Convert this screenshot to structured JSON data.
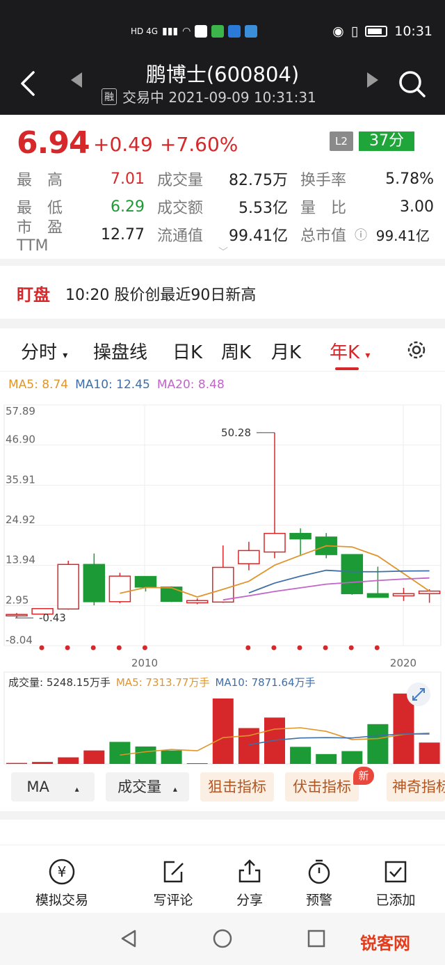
{
  "status": {
    "left_label": "HD 4G",
    "time": "10:31"
  },
  "header": {
    "title": "鹏博士(600804)",
    "rong": "融",
    "subtitle": "交易中 2021-09-09 10:31:31"
  },
  "quote": {
    "price": "6.94",
    "change": "+0.49",
    "change_pct": "+7.60%",
    "l2": "L2",
    "score": "37分",
    "rows": [
      {
        "l1": "最　高",
        "v1": "7.01",
        "l2": "成交量",
        "v2": "82.75万",
        "l3": "换手率",
        "v3": "5.78%"
      },
      {
        "l1": "最　低",
        "v1": "6.29",
        "l2": "成交额",
        "v2": "5.53亿",
        "l3": "量　比",
        "v3": "3.00"
      },
      {
        "l1": "市　盈TTM",
        "v1": "12.77",
        "l2": "流通值",
        "v2": "99.41亿",
        "l3": "总市值",
        "v3": "99.41亿"
      }
    ]
  },
  "watch": {
    "tag": "盯盘",
    "text": "10:20 股价创最近90日新高"
  },
  "tabs": [
    "分时",
    "操盘线",
    "日K",
    "周K",
    "月K",
    "年K"
  ],
  "ma_legend": {
    "ma5": "MA5: 8.74",
    "ma10": "MA10: 12.45",
    "ma20": "MA20: 8.48"
  },
  "colors": {
    "up": "#d6282a",
    "down": "#1c9a35",
    "ma5": "#e0952c",
    "ma10": "#3f6ea6",
    "ma20": "#c264c8"
  },
  "chart_data": [
    {
      "type": "candlestick",
      "title": "",
      "y_ticks": [
        "57.89",
        "46.90",
        "35.91",
        "24.92",
        "13.94",
        "2.95",
        "-8.04"
      ],
      "ylim": [
        -8.04,
        57.89
      ],
      "x_tick_labels": [
        "2010",
        "2020"
      ],
      "annotations": [
        "50.28",
        "-0.43"
      ],
      "candles": [
        {
          "year": 2006,
          "open": 0.5,
          "close": 0.5,
          "high": 0.9,
          "low": -0.43
        },
        {
          "year": 2007,
          "open": 0.6,
          "close": 2.1,
          "high": 2.2,
          "low": 0.5
        },
        {
          "year": 2008,
          "open": 2.0,
          "close": 14.2,
          "high": 15.2,
          "low": 1.8
        },
        {
          "year": 2009,
          "open": 14.2,
          "close": 4.0,
          "high": 17.2,
          "low": 3.0
        },
        {
          "year": 2010,
          "open": 4.0,
          "close": 11.0,
          "high": 11.9,
          "low": 3.6
        },
        {
          "year": 2011,
          "open": 10.9,
          "close": 8.0,
          "high": 10.9,
          "low": 6.8
        },
        {
          "year": 2012,
          "open": 8.0,
          "close": 4.1,
          "high": 8.2,
          "low": 3.9
        },
        {
          "year": 2013,
          "open": 3.7,
          "close": 4.3,
          "high": 4.9,
          "low": 3.3
        },
        {
          "year": 2014,
          "open": 3.9,
          "close": 13.4,
          "high": 19.4,
          "low": 3.7
        },
        {
          "year": 2015,
          "open": 14.4,
          "close": 18.0,
          "high": 20.4,
          "low": 12.6
        },
        {
          "year": 2016,
          "open": 17.6,
          "close": 22.7,
          "high": 50.28,
          "low": 15.9
        },
        {
          "year": 2017,
          "open": 22.7,
          "close": 21.2,
          "high": 24.1,
          "low": 16.5
        },
        {
          "year": 2018,
          "open": 21.7,
          "close": 16.9,
          "high": 22.8,
          "low": 15.9
        },
        {
          "year": 2019,
          "open": 16.9,
          "close": 6.2,
          "high": 16.9,
          "low": 5.9
        },
        {
          "year": 2020,
          "open": 6.2,
          "close": 5.2,
          "high": 13.6,
          "low": 5.1
        },
        {
          "year": 2021,
          "open": 5.6,
          "close": 6.2,
          "high": 7.8,
          "low": 4.2
        },
        {
          "year": 2021,
          "open": 6.2,
          "close": 6.9,
          "high": 7.4,
          "low": 3.7
        }
      ],
      "ma5": [
        null,
        null,
        null,
        null,
        6.3,
        7.9,
        7.8,
        5.3,
        7.4,
        9.6,
        14.0,
        16.7,
        19.3,
        19.0,
        16.5,
        11.7,
        6.9
      ],
      "ma10": [
        null,
        null,
        null,
        null,
        null,
        null,
        null,
        null,
        null,
        6.4,
        9.1,
        11.0,
        12.6,
        12.2,
        12.2,
        12.4,
        12.45
      ],
      "ma20": [
        null,
        null,
        null,
        null,
        null,
        null,
        null,
        null,
        null,
        null,
        null,
        null,
        null,
        null,
        null,
        null,
        null
      ]
    },
    {
      "type": "bar",
      "title": "",
      "legend": [
        "成交量: 5248.15万手",
        "MA5: 7313.77万手",
        "MA10: 7871.64万手"
      ],
      "volumes": [
        0.3,
        0.6,
        2.0,
        4.1,
        6.7,
        5.3,
        4.1,
        0.0,
        19.9,
        10.9,
        14.1,
        5.2,
        3.0,
        3.9,
        12.1,
        21.4,
        6.5
      ],
      "directions": [
        "up",
        "up",
        "up",
        "up",
        "down",
        "down",
        "down",
        "up",
        "up",
        "up",
        "up",
        "down",
        "down",
        "down",
        "down",
        "up",
        "up"
      ],
      "ma5": [
        null,
        null,
        null,
        null,
        2.7,
        3.7,
        4.4,
        4.0,
        8.0,
        8.6,
        10.6,
        11.0,
        9.9,
        7.4,
        7.7,
        9.0,
        9.4
      ],
      "ma10": [
        null,
        null,
        null,
        null,
        null,
        null,
        null,
        null,
        null,
        5.8,
        7.2,
        7.9,
        8.0,
        7.9,
        8.6,
        9.1,
        9.1
      ]
    }
  ],
  "indicators": {
    "ma": "MA",
    "volume": "成交量",
    "btn1": "狙击指标",
    "btn2": "伏击指标",
    "btn3": "神奇指标",
    "new_badge": "新"
  },
  "bottom": {
    "items": [
      "模拟交易",
      "写评论",
      "分享",
      "预警",
      "已添加"
    ]
  },
  "watermark": "锐客网"
}
